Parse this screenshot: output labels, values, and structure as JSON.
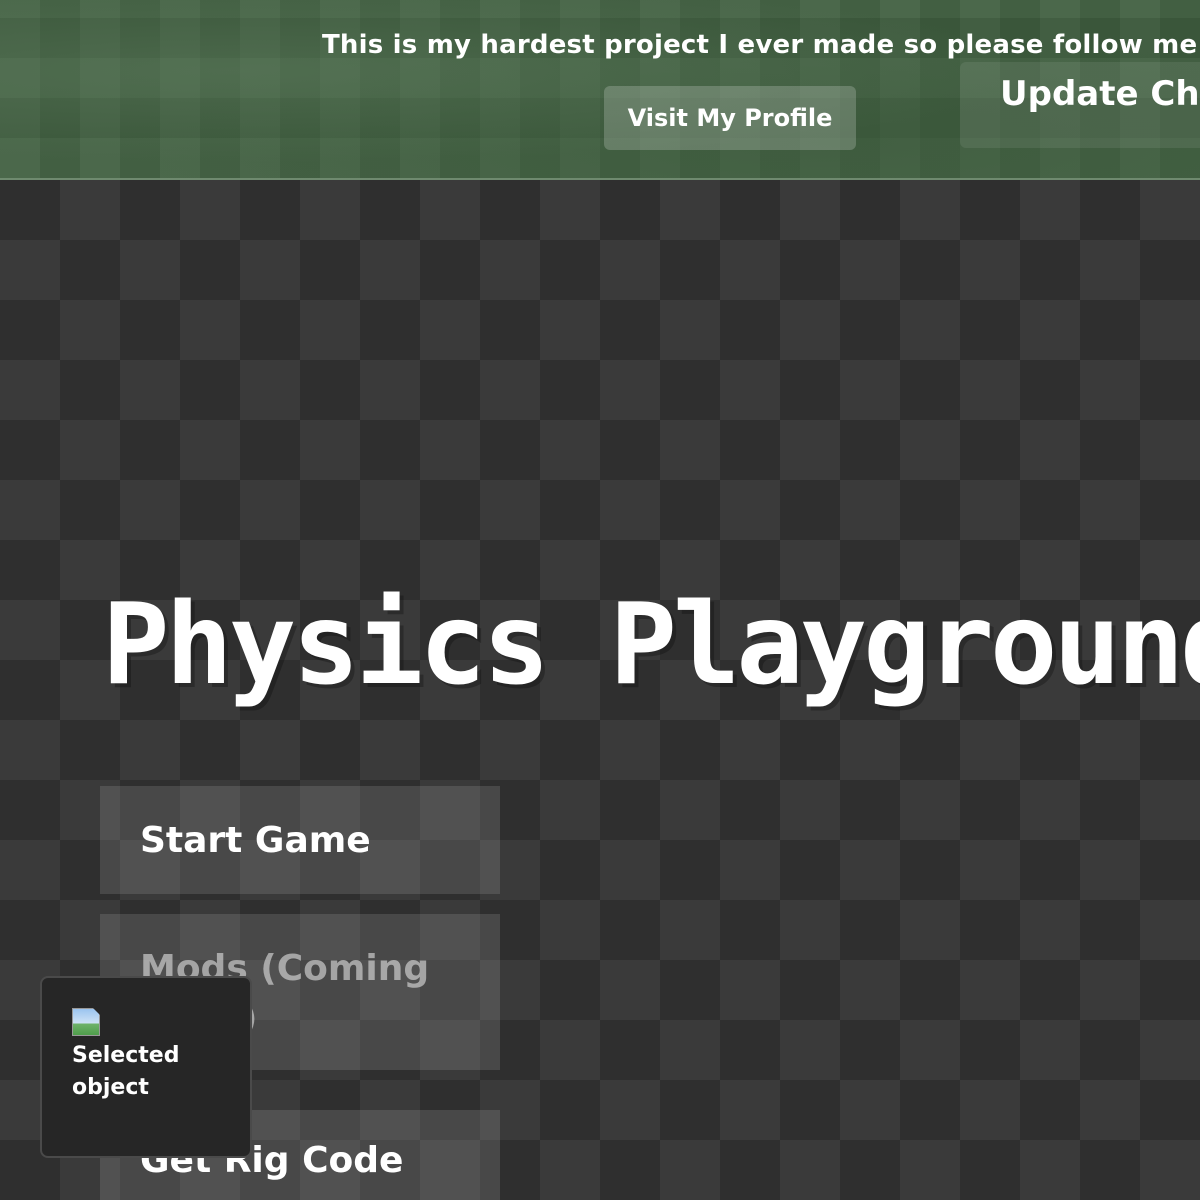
{
  "banner": {
    "message": "This is my hardest project I ever made so please follow me!",
    "visit_profile_label": "Visit My Profile",
    "update_label": "Update Cha"
  },
  "title": "Physics Playground",
  "menu": {
    "start_label": "Start Game",
    "mods_label": "Mods (Coming Soon)",
    "rig_label": "Get Rig Code"
  },
  "selected_panel": {
    "icon": "broken-image-icon",
    "label": "Selected object"
  },
  "colors": {
    "banner_green": "#3f5e3f",
    "checker_dark": "#2f2f2f",
    "checker_light": "#444444",
    "text": "#ffffff"
  }
}
